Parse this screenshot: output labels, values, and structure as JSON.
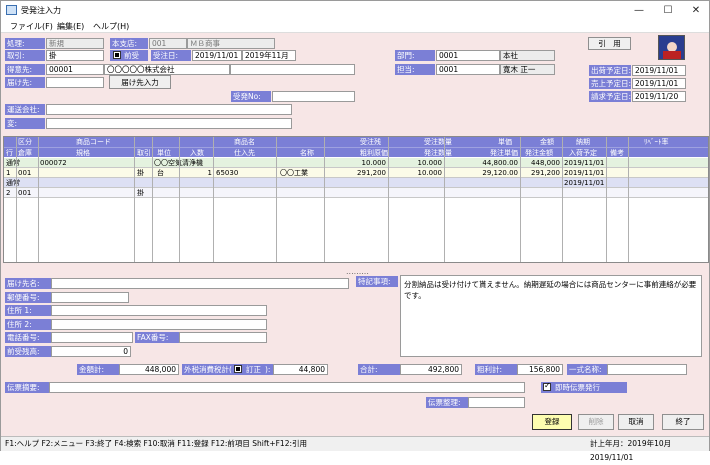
{
  "window": {
    "title": "受発注入力",
    "minimize": "—",
    "maximize": "☐",
    "close": "✕"
  },
  "menu": [
    "ファイル(F)",
    "編集(E)",
    "ヘルプ(H)"
  ],
  "header": {
    "processing_label": "処理:",
    "processing_value": "新規",
    "branch_label": "本支店:",
    "branch_code": "001",
    "branch_name": "ＭＢ商事",
    "transaction_label": "取引:",
    "transaction_value": "掛",
    "prev_order_label": "前受",
    "order_date_label": "受注日:",
    "order_date": "2019/11/01",
    "order_month": "2019年11月",
    "department_label": "部門:",
    "department_code": "0001",
    "department_name": "本社",
    "customer_label": "得意先:",
    "customer_code": "00001",
    "customer_name": "〇〇〇〇〇株式会社",
    "staff_label": "担当:",
    "staff_code": "0001",
    "staff_name": "寛木 正一",
    "delivery_label": "届け先:",
    "delivery_input_button": "届け先入力",
    "quote_button": "引　用",
    "shipping_company_label": "運送会社:",
    "memo_label": "変:",
    "order_no_label": "受発No:",
    "ship_date_label": "出荷予定日:",
    "ship_date": "2019/11/01",
    "sales_date_label": "売上予定日:",
    "sales_date": "2019/11/01",
    "billing_date_label": "請求予定日:",
    "billing_date": "2019/11/20"
  },
  "grid": {
    "header_row1": [
      "区分",
      "商品コード",
      "商品名",
      "受注残",
      "受注数量",
      "単価",
      "金額",
      "納期",
      "ﾘﾍﾞｰﾄ率"
    ],
    "header_row2": [
      "行",
      "倉庫",
      "規格",
      "取引",
      "単位",
      "入数",
      "仕入先",
      "名称",
      "粗利原価",
      "発注数量",
      "発注単価",
      "発注金額",
      "入荷予定",
      "備考"
    ],
    "rows": [
      {
        "r1": [
          "通常",
          "",
          "000072",
          "",
          "〇〇空気清浄機",
          "",
          "10.000",
          "10.000",
          "44,800.00",
          "448,000",
          "2019/11/01",
          ""
        ],
        "r2": [
          "1",
          "001",
          "",
          "掛",
          "台",
          "1",
          "65030",
          "〇〇工業",
          "291,200",
          "10.000",
          "29,120.00",
          "291,200",
          "2019/11/01",
          ""
        ]
      },
      {
        "r1": [
          "通常",
          "",
          "",
          "",
          "",
          "",
          "",
          "",
          "",
          "",
          "2019/11/01",
          ""
        ],
        "r2": [
          "2",
          "001",
          "",
          "掛",
          "",
          "",
          "",
          "",
          "",
          "",
          "2019/11/01",
          ""
        ]
      }
    ]
  },
  "delivery": {
    "name_label": "届け先名:",
    "zip_label": "郵便番号:",
    "address1_label": "住所 1:",
    "address2_label": "住所 2:",
    "phone_label": "電話番号:",
    "fax_label": "FAX番号:",
    "prev_balance_label": "前受残高:",
    "prev_balance": "0",
    "notes_label": "特記事項:",
    "notes_text": "分割納品は受け付けて貰えません。納期遅延の場合には商品センターに事前連絡が必要です。"
  },
  "totals": {
    "amount_label": "金額計:",
    "amount": "448,000",
    "tax_label": "外税消費税計(",
    "tax_flag": "訂正",
    "tax_close": "):",
    "tax": "44,800",
    "total_label": "合計:",
    "total": "492,800",
    "profit_label": "粗利計:",
    "profit": "156,800",
    "lump_label": "一式名称:"
  },
  "slip": {
    "summary_label": "伝票摘要:",
    "manager_label": "伝票整理:",
    "instant_issue_label": "即時伝票発行"
  },
  "buttons": {
    "register": "登録",
    "delete": "削除",
    "cancel": "取消",
    "exit": "終了"
  },
  "status": {
    "keys": "F1:ヘルプ  F2:メニュー  F3:終了  F4:検索  F10:取消  F11:登録  F12:前項目  Shift+F12:引用",
    "period": "計上年月：2019年10月  2019/11/01"
  }
}
